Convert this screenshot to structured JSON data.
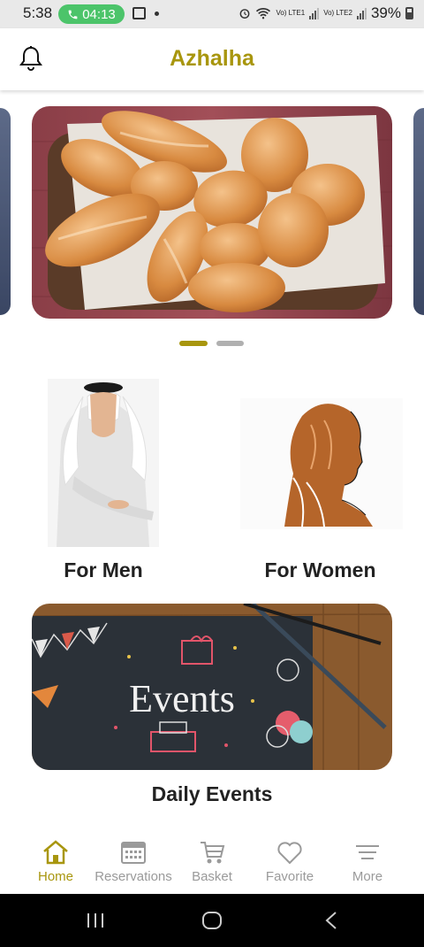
{
  "status_bar": {
    "time": "5:38",
    "call_timer": "04:13",
    "sim1_label": "Vo) LTE1",
    "sim2_label": "Vo) LTE2",
    "battery": "39%"
  },
  "header": {
    "title": "Azhalha",
    "bell_icon": "bell-icon"
  },
  "carousel": {
    "slide_count": 2,
    "active_index": 0
  },
  "categories": [
    {
      "label": "For Men"
    },
    {
      "label": "For Women"
    }
  ],
  "events": {
    "title": "Daily Events",
    "card_text": "Events"
  },
  "bottom_nav": [
    {
      "label": "Home",
      "icon": "home-icon",
      "active": true
    },
    {
      "label": "Reservations",
      "icon": "calendar-icon",
      "active": false
    },
    {
      "label": "Basket",
      "icon": "cart-icon",
      "active": false
    },
    {
      "label": "Favorite",
      "icon": "heart-icon",
      "active": false
    },
    {
      "label": "More",
      "icon": "menu-icon",
      "active": false
    }
  ],
  "colors": {
    "accent": "#a8960e",
    "inactive": "#9a9a9a",
    "call_green": "#4cc46a"
  }
}
